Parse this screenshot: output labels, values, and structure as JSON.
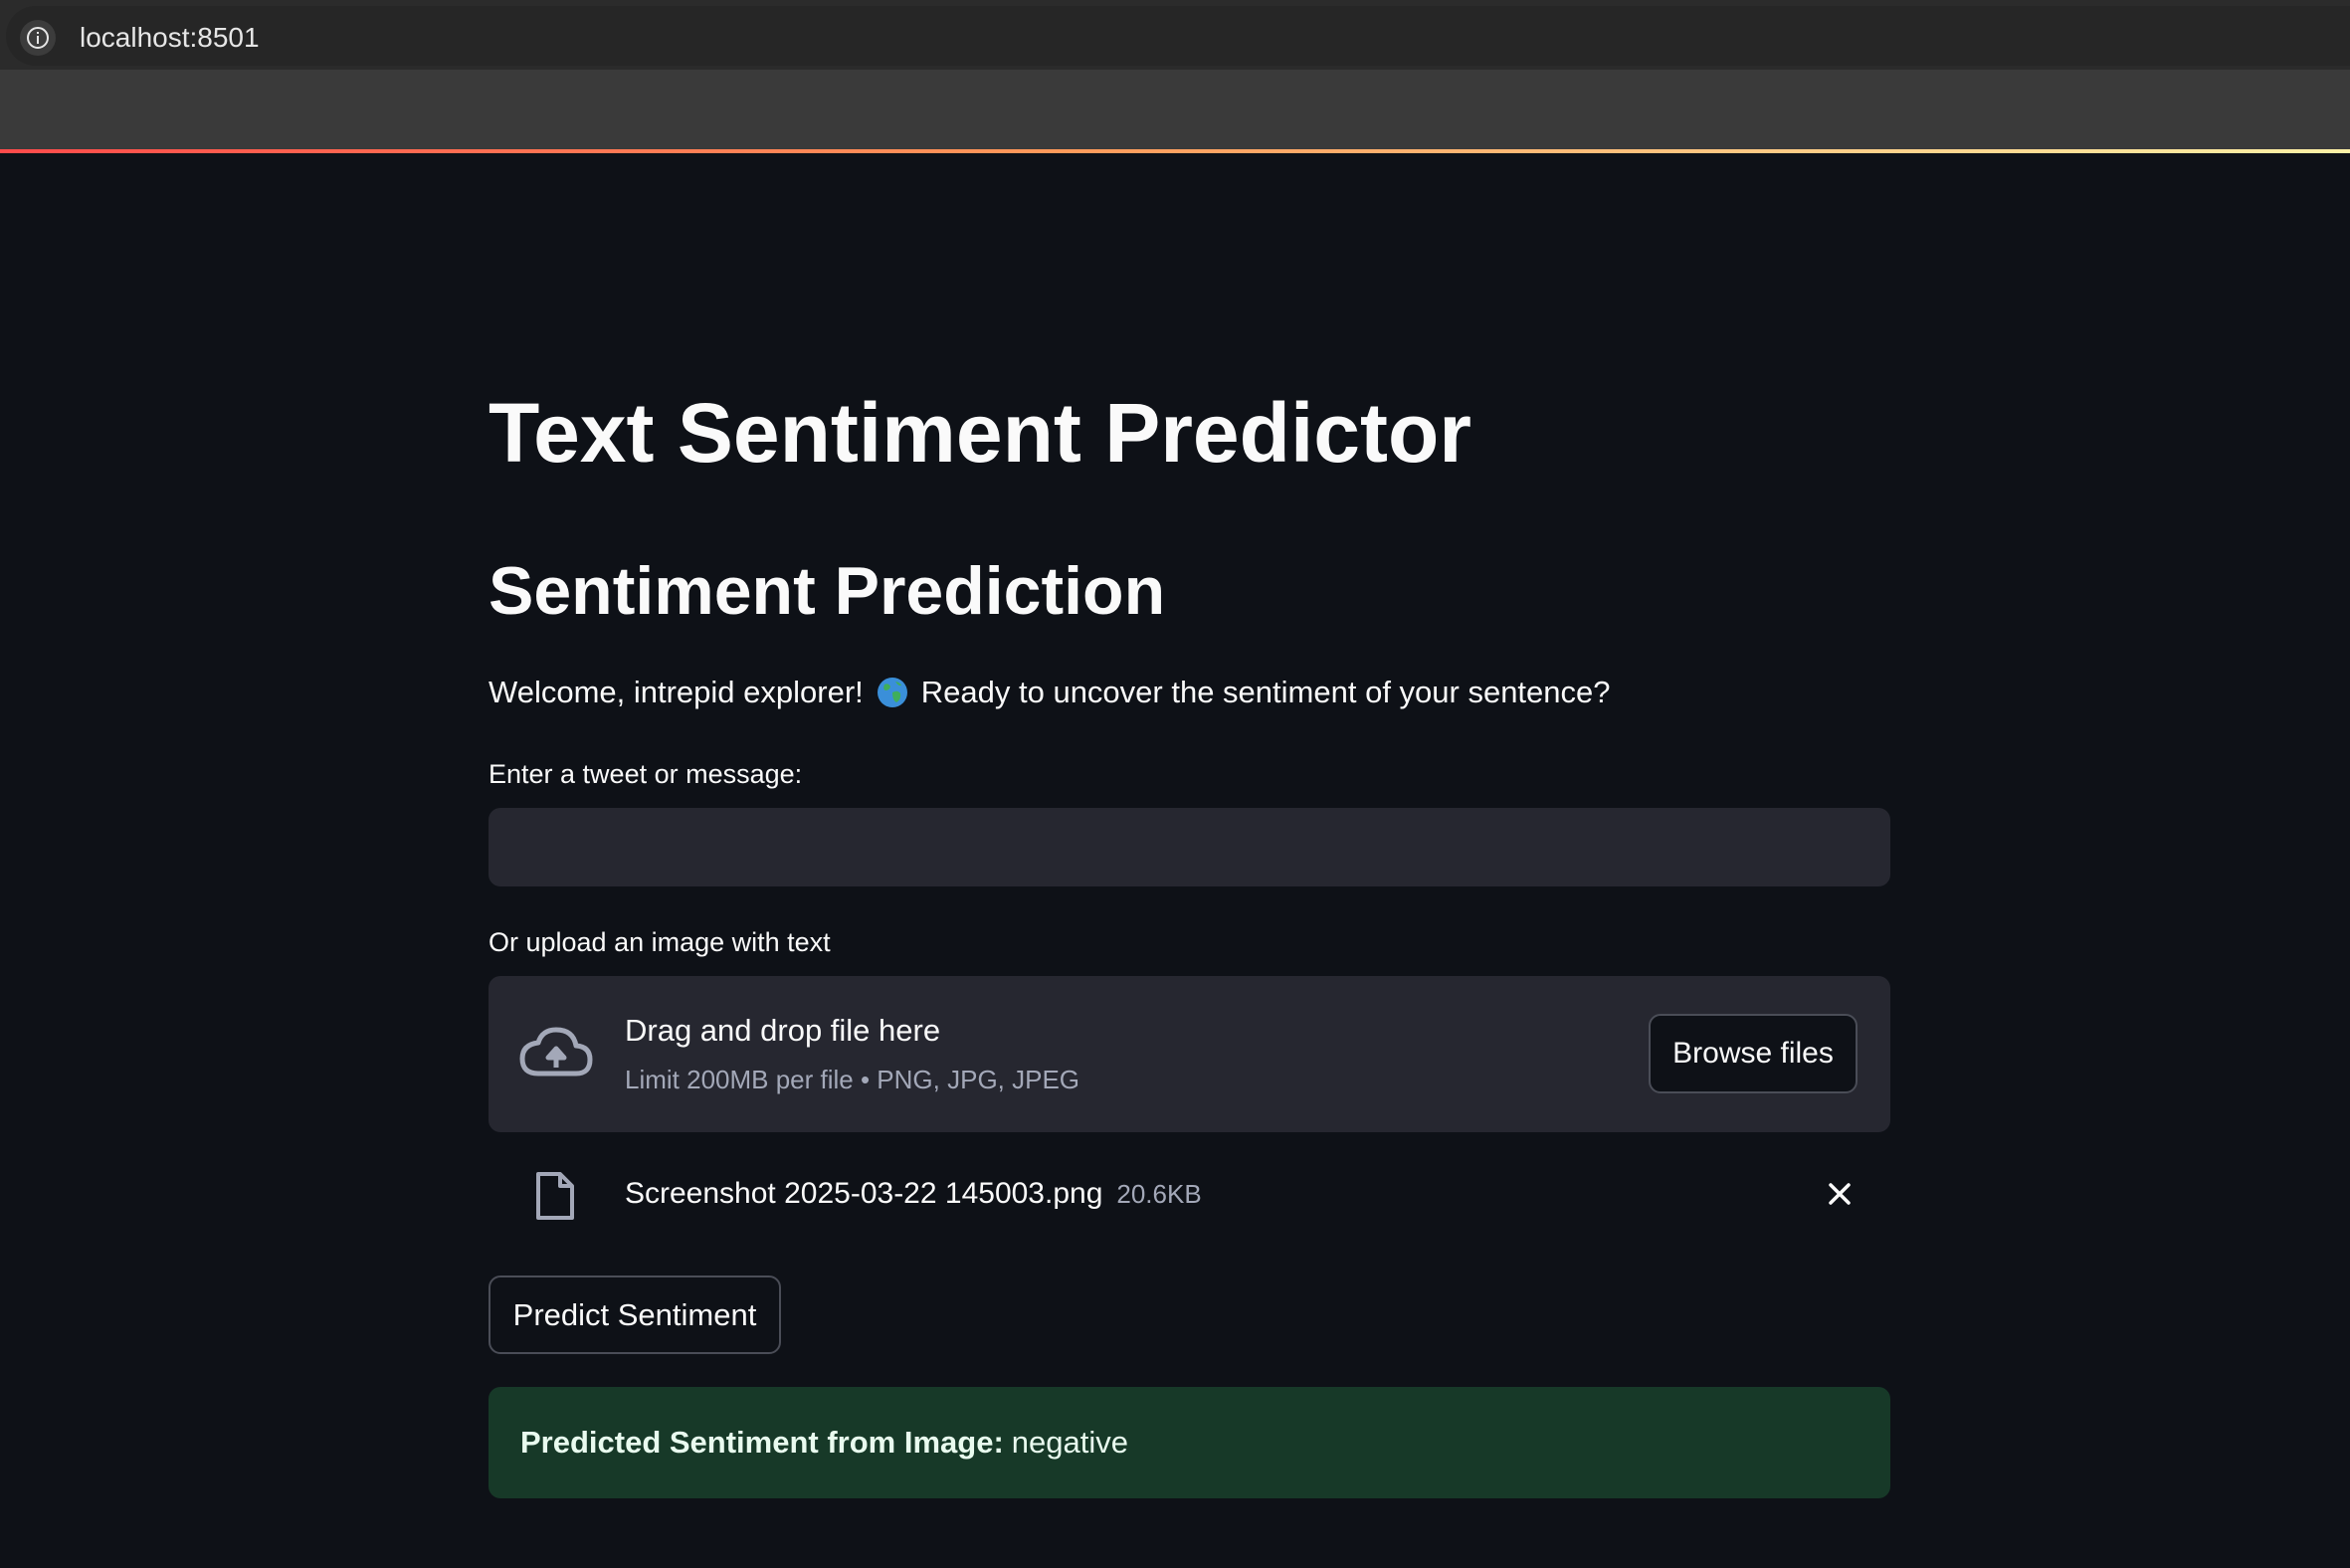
{
  "browser": {
    "url": "localhost:8501"
  },
  "colors": {
    "background": "#0e1117",
    "input_bg": "#262730",
    "success_bg": "#173928",
    "accent_start": "#ff4b4b",
    "accent_end": "#fdf1a7"
  },
  "page": {
    "title": "Text Sentiment Predictor",
    "section_title": "Sentiment Prediction",
    "welcome_before": "Welcome, intrepid explorer!",
    "welcome_icon": "globe-emoji",
    "welcome_after": "Ready to uncover the sentiment of your sentence?"
  },
  "text_input": {
    "label": "Enter a tweet or message:",
    "value": ""
  },
  "uploader": {
    "label": "Or upload an image with text",
    "drop_text": "Drag and drop file here",
    "limit_text": "Limit 200MB per file • PNG, JPG, JPEG",
    "browse_label": "Browse files",
    "file_name": "Screenshot 2025-03-22 145003.png",
    "file_size": "20.6KB"
  },
  "predict_button": {
    "label": "Predict Sentiment"
  },
  "result": {
    "label": "Predicted Sentiment from Image:",
    "value": "negative"
  }
}
